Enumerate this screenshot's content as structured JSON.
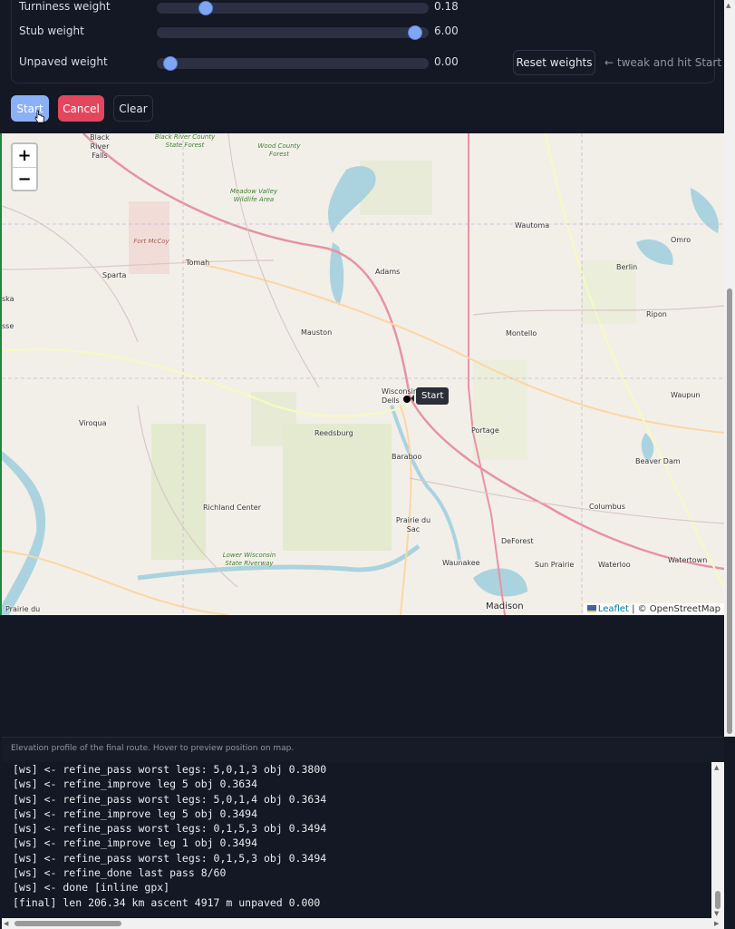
{
  "weights": [
    {
      "label": "Turniness weight",
      "value": "0.18",
      "level": 0.18
    },
    {
      "label": "Stub weight",
      "value": "6.00",
      "level": 0.95
    },
    {
      "label": "Unpaved weight",
      "value": "0.00",
      "level": 0.05
    }
  ],
  "reset_label": "Reset weights",
  "hint": "← tweak and hit Start",
  "buttons": {
    "start": "Start",
    "cancel": "Cancel",
    "clear": "Clear"
  },
  "map": {
    "zoom_in": "+",
    "zoom_out": "−",
    "marker_tooltip": "Start",
    "attribution_leaflet": "Leaflet",
    "attribution_rest": "| © OpenStreetMap",
    "places": [
      {
        "id": "black-river-falls",
        "text": "Black River Falls"
      },
      {
        "id": "tomah",
        "text": "Tomah"
      },
      {
        "id": "sparta",
        "text": "Sparta"
      },
      {
        "id": "adams",
        "text": "Adams"
      },
      {
        "id": "mauston",
        "text": "Mauston"
      },
      {
        "id": "wautoma",
        "text": "Wautoma"
      },
      {
        "id": "omro",
        "text": "Omro"
      },
      {
        "id": "berlin",
        "text": "Berlin"
      },
      {
        "id": "ripon",
        "text": "Ripon"
      },
      {
        "id": "montello",
        "text": "Montello"
      },
      {
        "id": "waupun",
        "text": "Waupun"
      },
      {
        "id": "wisconsin-dells",
        "text": "Wisconsin Dells"
      },
      {
        "id": "viroqua",
        "text": "Viroqua"
      },
      {
        "id": "reedsburg",
        "text": "Reedsburg"
      },
      {
        "id": "portage",
        "text": "Portage"
      },
      {
        "id": "baraboo",
        "text": "Baraboo"
      },
      {
        "id": "beaver-dam",
        "text": "Beaver Dam"
      },
      {
        "id": "richland-center",
        "text": "Richland Center"
      },
      {
        "id": "columbus",
        "text": "Columbus"
      },
      {
        "id": "prairie-du-sac",
        "text": "Prairie du Sac"
      },
      {
        "id": "deforest",
        "text": "DeForest"
      },
      {
        "id": "waunakee",
        "text": "Waunakee"
      },
      {
        "id": "sun-prairie",
        "text": "Sun Prairie"
      },
      {
        "id": "waterloo",
        "text": "Waterloo"
      },
      {
        "id": "watertown",
        "text": "Watertown"
      },
      {
        "id": "madison",
        "text": "Madison"
      },
      {
        "id": "prairie-du",
        "text": "Prairie du"
      },
      {
        "id": "ska",
        "text": "ska"
      },
      {
        "id": "sse",
        "text": "sse"
      }
    ],
    "parks": [
      {
        "id": "black-river-sf",
        "text": "Black River County State Forest"
      },
      {
        "id": "wood-county-forest",
        "text": "Wood County Forest"
      },
      {
        "id": "meadow-valley",
        "text": "Meadow Valley Wildlife Area"
      },
      {
        "id": "fort-mccoy",
        "text": "Fort McCoy"
      },
      {
        "id": "lower-wisconsin",
        "text": "Lower Wisconsin State Riverway"
      }
    ]
  },
  "elevation_caption": "Elevation profile of the final route. Hover to preview position on map.",
  "log_lines": [
    "[ws] <- refine_pass worst legs: 5,0,1,3 obj 0.3800",
    "[ws] <- refine_improve leg 5 obj 0.3634",
    "[ws] <- refine_pass worst legs: 5,0,1,4 obj 0.3634",
    "[ws] <- refine_improve leg 5 obj 0.3494",
    "[ws] <- refine_pass worst legs: 0,1,5,3 obj 0.3494",
    "[ws] <- refine_improve leg 1 obj 0.3494",
    "[ws] <- refine_pass worst legs: 0,1,5,3 obj 0.3494",
    "[ws] <- refine_done last pass 8/60",
    "[ws] <- done [inline gpx]",
    "[final] len 206.34 km ascent 4917 m unpaved 0.000"
  ]
}
